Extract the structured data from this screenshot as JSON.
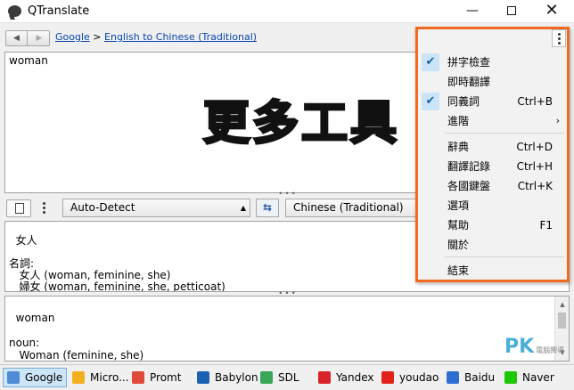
{
  "window": {
    "title": "QTranslate"
  },
  "breadcrumb": {
    "service": "Google",
    "separator": ">",
    "direction": "English to Chinese (Traditional)"
  },
  "source_text": "woman",
  "overlay_text": "更多工具",
  "languages": {
    "source": "Auto-Detect",
    "target": "Chinese (Traditional)"
  },
  "result_text": "女人\n\n名詞:\n   女人 (woman, feminine, she)\n   婦女 (woman, feminine, she, petticoat)\n   女子 (woman, female, she, frail)",
  "back_translation": "woman\n\nnoun:\n   Woman (feminine, she)\n   Woman (feminine, she, petticoat)",
  "watermark": {
    "main": "PK",
    "sub": "電腦嚮導"
  },
  "menu": {
    "items": [
      {
        "label": "拼字檢查",
        "shortcut": "",
        "checked": true,
        "submenu": false
      },
      {
        "label": "即時翻譯",
        "shortcut": "",
        "checked": false,
        "submenu": false
      },
      {
        "label": "同義詞",
        "shortcut": "Ctrl+B",
        "checked": true,
        "submenu": false
      },
      {
        "label": "進階",
        "shortcut": "",
        "checked": false,
        "submenu": true
      },
      {
        "label": "辭典",
        "shortcut": "Ctrl+D",
        "checked": false,
        "submenu": false
      },
      {
        "label": "翻譯記錄",
        "shortcut": "Ctrl+H",
        "checked": false,
        "submenu": false
      },
      {
        "label": "各國鍵盤",
        "shortcut": "Ctrl+K",
        "checked": false,
        "submenu": false
      },
      {
        "label": "選項",
        "shortcut": "",
        "checked": false,
        "submenu": false
      },
      {
        "label": "幫助",
        "shortcut": "F1",
        "checked": false,
        "submenu": false
      },
      {
        "label": "關於",
        "shortcut": "",
        "checked": false,
        "submenu": false
      },
      {
        "label": "結束",
        "shortcut": "",
        "checked": false,
        "submenu": false
      }
    ],
    "checkmark": "✔",
    "submenu_arrow": "›"
  },
  "services": [
    {
      "label": "Google",
      "icon": "google-icon",
      "color": "#4f8bd6",
      "active": true
    },
    {
      "label": "Micro...",
      "icon": "bing-icon",
      "color": "#f2b01e",
      "active": false
    },
    {
      "label": "Promt",
      "icon": "promt-icon",
      "color": "#e04a3a",
      "active": false
    },
    {
      "label": "Babylon",
      "icon": "babylon-icon",
      "color": "#1b62b5",
      "active": false
    },
    {
      "label": "SDL",
      "icon": "sdl-icon",
      "color": "#3aa657",
      "active": false
    },
    {
      "label": "Yandex",
      "icon": "yandex-icon",
      "color": "#d8232a",
      "active": false
    },
    {
      "label": "youdao",
      "icon": "youdao-icon",
      "color": "#e2231a",
      "active": false
    },
    {
      "label": "Baidu",
      "icon": "baidu-icon",
      "color": "#2d6fd1",
      "active": false
    },
    {
      "label": "Naver",
      "icon": "naver-icon",
      "color": "#1ec800",
      "active": false
    }
  ]
}
